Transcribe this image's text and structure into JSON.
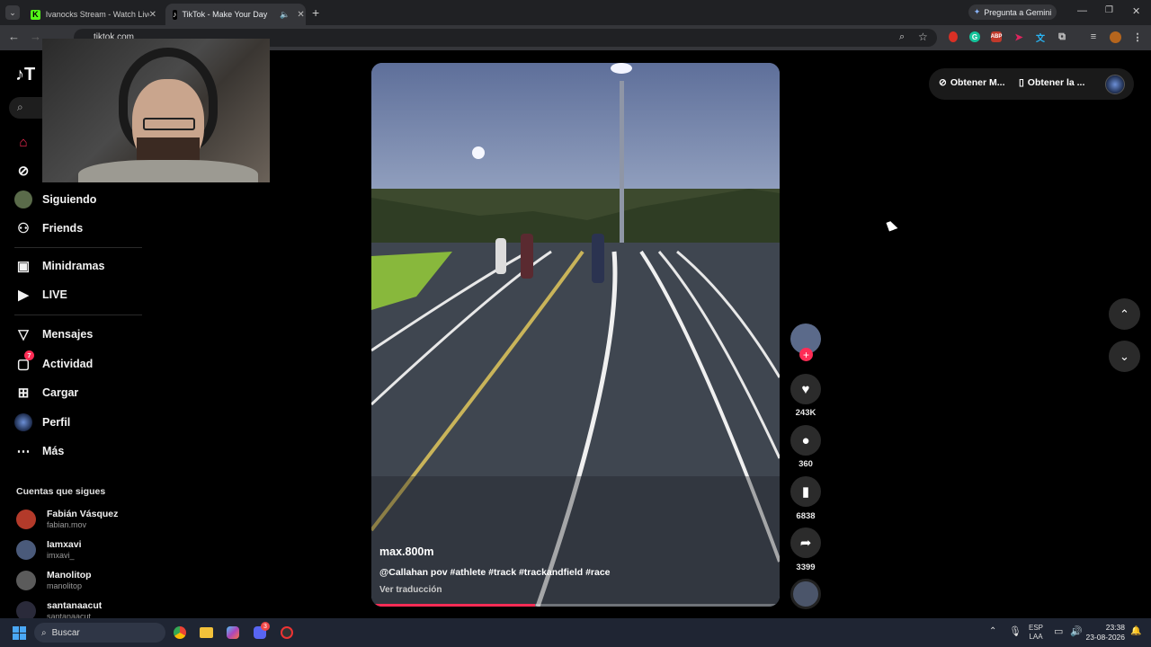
{
  "browser": {
    "tabs": [
      {
        "title": "Ivanocks Stream - Watch Live o",
        "icon": "K"
      },
      {
        "title": "TikTok - Make Your Day",
        "icon": "tiktok"
      }
    ],
    "gemini_label": "Pregunta a Gemini",
    "url": "tiktok.com"
  },
  "sidebar": {
    "items": [
      {
        "label": "",
        "icon": "home-icon"
      },
      {
        "label": "",
        "icon": "compass-icon"
      },
      {
        "label": "Siguiendo",
        "icon": "avatar"
      },
      {
        "label": "Friends",
        "icon": "friends-icon"
      },
      {
        "label": "Minidramas",
        "icon": "film-icon"
      },
      {
        "label": "LIVE",
        "icon": "live-icon"
      },
      {
        "label": "Mensajes",
        "icon": "send-icon"
      },
      {
        "label": "Actividad",
        "icon": "activity-icon",
        "badge": "7"
      },
      {
        "label": "Cargar",
        "icon": "plus-square-icon"
      },
      {
        "label": "Perfil",
        "icon": "profile-avatar"
      },
      {
        "label": "Más",
        "icon": "more-icon"
      }
    ],
    "following_title": "Cuentas que sigues",
    "following": [
      {
        "name": "Fabián Vásquez",
        "user": "fabian.mov"
      },
      {
        "name": "Iamxavi",
        "user": "imxavi_"
      },
      {
        "name": "Manolitop",
        "user": "manolitop"
      },
      {
        "name": "santanaacut",
        "user": "santanaacut"
      }
    ]
  },
  "top_right": {
    "btn1": "Obtener M...",
    "btn2": "Obtener la ..."
  },
  "video": {
    "author": "max.800m",
    "caption": "@Callahan pov #athlete #track #trackandfield #race",
    "translate": "Ver traducción",
    "progress": 0.4
  },
  "actions": {
    "likes": "243K",
    "comments": "360",
    "saves": "6838",
    "shares": "3399"
  },
  "taskbar": {
    "search": "Buscar",
    "lang1": "ESP",
    "lang2": "LAA",
    "time": "23:38",
    "date": "23-08-2026",
    "discord_badge": "3"
  }
}
